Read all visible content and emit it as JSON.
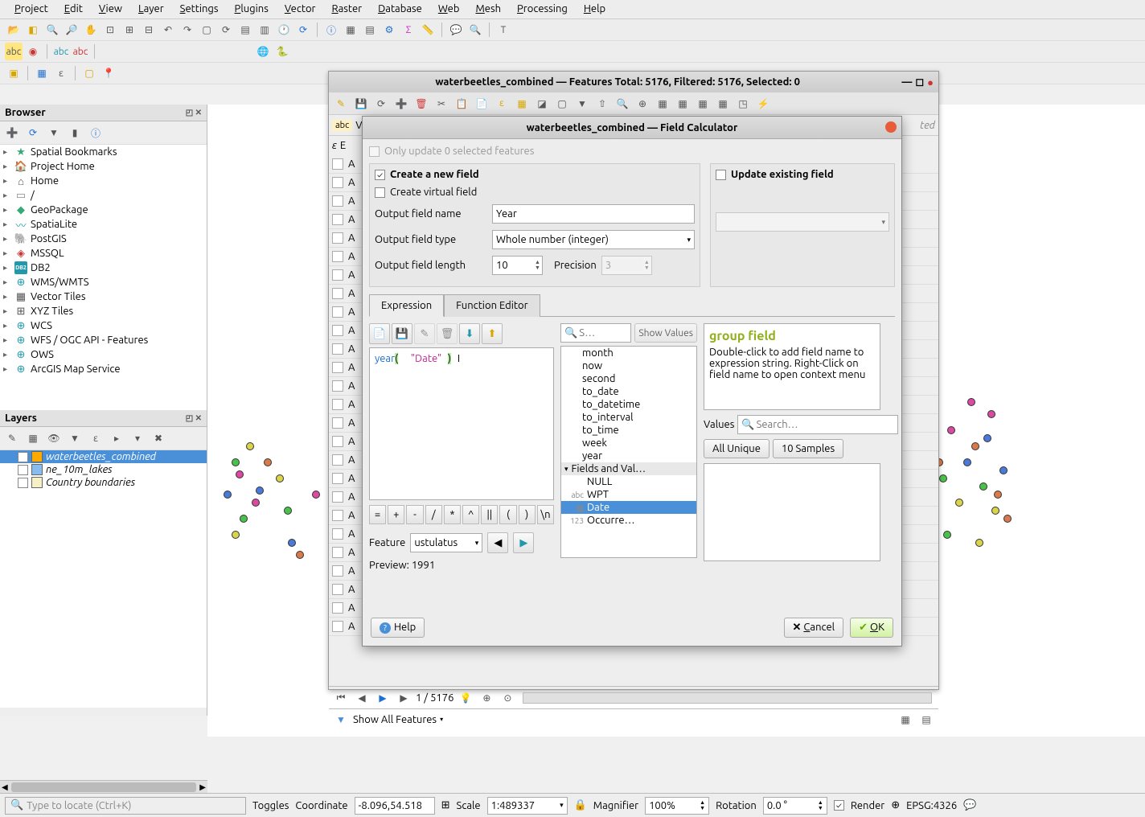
{
  "menu": [
    "Project",
    "Edit",
    "View",
    "Layer",
    "Settings",
    "Plugins",
    "Vector",
    "Raster",
    "Database",
    "Web",
    "Mesh",
    "Processing",
    "Help"
  ],
  "browser": {
    "title": "Browser",
    "items": [
      {
        "icon": "★",
        "label": "Spatial Bookmarks",
        "color": "#3a7"
      },
      {
        "icon": "🏠",
        "label": "Project Home",
        "color": "#3a7"
      },
      {
        "icon": "⌂",
        "label": "Home",
        "color": "#555"
      },
      {
        "icon": "▭",
        "label": "/",
        "color": "#888"
      },
      {
        "icon": "◆",
        "label": "GeoPackage",
        "color": "#3a7"
      },
      {
        "icon": "〰",
        "label": "SpatiaLite",
        "color": "#29a"
      },
      {
        "icon": "🐘",
        "label": "PostGIS",
        "color": "#29a"
      },
      {
        "icon": "◈",
        "label": "MSSQL",
        "color": "#c33"
      },
      {
        "icon": "DB2",
        "label": "DB2",
        "color": "#29a",
        "small": true
      },
      {
        "icon": "⊕",
        "label": "WMS/WMTS",
        "color": "#29a"
      },
      {
        "icon": "▦",
        "label": "Vector Tiles",
        "color": "#555"
      },
      {
        "icon": "⊞",
        "label": "XYZ Tiles",
        "color": "#555"
      },
      {
        "icon": "⊕",
        "label": "WCS",
        "color": "#29a"
      },
      {
        "icon": "⊕",
        "label": "WFS / OGC API - Features",
        "color": "#29a"
      },
      {
        "icon": "⊕",
        "label": "OWS",
        "color": "#29a"
      },
      {
        "icon": "⊕",
        "label": "ArcGIS Map Service",
        "color": "#29a"
      }
    ]
  },
  "layers": {
    "title": "Layers",
    "items": [
      {
        "checked": true,
        "color": "#ffaa00",
        "label": "waterbeetles_combined",
        "italic": true,
        "sel": true
      },
      {
        "checked": false,
        "color": "#88bbee",
        "label": "ne_10m_lakes",
        "italic": true
      },
      {
        "checked": false,
        "color": "#f5f0c5",
        "label": "Country boundaries",
        "italic": true
      }
    ]
  },
  "attr": {
    "title": "waterbeetles_combined — Features Total: 5176, Filtered: 5176, Selected: 0",
    "nav": "1 / 5176",
    "footer": "Show All Features"
  },
  "calc": {
    "title": "waterbeetles_combined — Field Calculator",
    "only_update": "Only update 0 selected features",
    "create_new": "Create a new field",
    "update_ex": "Update existing field",
    "virtual": "Create virtual field",
    "out_name_lbl": "Output field name",
    "out_name": "Year",
    "out_type_lbl": "Output field type",
    "out_type": "Whole number (integer)",
    "out_len_lbl": "Output field length",
    "out_len": "10",
    "prec_lbl": "Precision",
    "prec": "3",
    "tab1": "Expression",
    "tab2": "Function Editor",
    "expr_func": "year",
    "expr_arg": "\"Date\"",
    "ops": [
      "=",
      "+",
      "-",
      "/",
      "*",
      "^",
      "||",
      "(",
      ")",
      "\\n"
    ],
    "search_ph": "S…",
    "show_vals": "Show Values",
    "funcs": [
      "month",
      "now",
      "second",
      "to_date",
      "to_datetime",
      "to_interval",
      "to_time",
      "week",
      "year"
    ],
    "fields_grp": "Fields and Val…",
    "field_items": [
      {
        "t": "NULL",
        "pre": ""
      },
      {
        "t": "WPT",
        "pre": "abc"
      },
      {
        "t": "Date",
        "pre": "▦",
        "sel": true
      },
      {
        "t": "Occurre…",
        "pre": "123"
      }
    ],
    "help_title": "group field",
    "help_text": "Double-click to add field name to expression string. Right-Click on field name to open context menu",
    "values_lbl": "Values",
    "val_search": "Search…",
    "all_unique": "All Unique",
    "samples": "10 Samples",
    "feature_lbl": "Feature",
    "feature_val": "ustulatus",
    "preview_lbl": "Preview:",
    "preview_val": "1991",
    "help_btn": "Help",
    "cancel": "Cancel",
    "ok": "OK"
  },
  "status": {
    "locator": "Type to locate (Ctrl+K)",
    "toggles": "Toggles",
    "coord_lbl": "Coordinate",
    "coord": "-8.096,54.518",
    "scale_lbl": "Scale",
    "scale": "1:489337",
    "mag_lbl": "Magnifier",
    "mag": "100%",
    "rot_lbl": "Rotation",
    "rot": "0.0 °",
    "render": "Render",
    "epsg": "EPSG:4326"
  }
}
